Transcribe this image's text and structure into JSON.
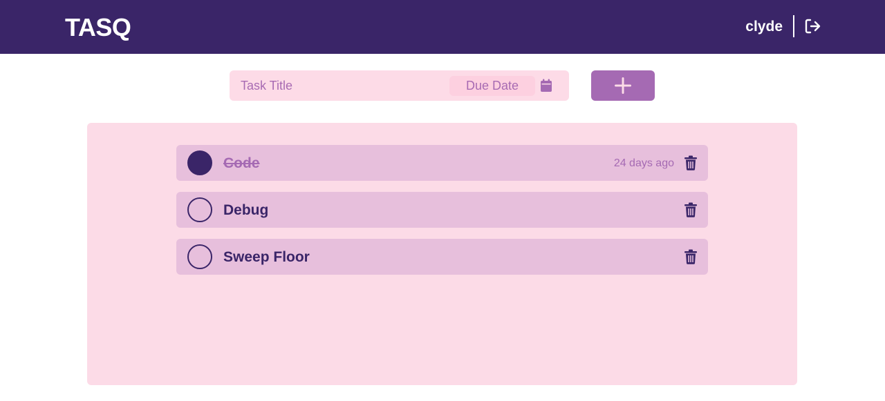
{
  "app": {
    "name": "TASQ"
  },
  "header": {
    "username": "clyde",
    "logout_icon": "logout-icon"
  },
  "form": {
    "title_placeholder": "Task Title",
    "due_date_placeholder": "Due Date",
    "calendar_icon": "calendar-icon",
    "add_icon": "plus-icon"
  },
  "colors": {
    "header_bg": "#3a2568",
    "accent": "#a56ab3",
    "panel_bg": "#fcdbe7",
    "task_bg": "#e7bfdc"
  },
  "tasks": [
    {
      "title": "Code",
      "done": true,
      "time": "24 days ago"
    },
    {
      "title": "Debug",
      "done": false,
      "time": ""
    },
    {
      "title": "Sweep Floor",
      "done": false,
      "time": ""
    }
  ]
}
